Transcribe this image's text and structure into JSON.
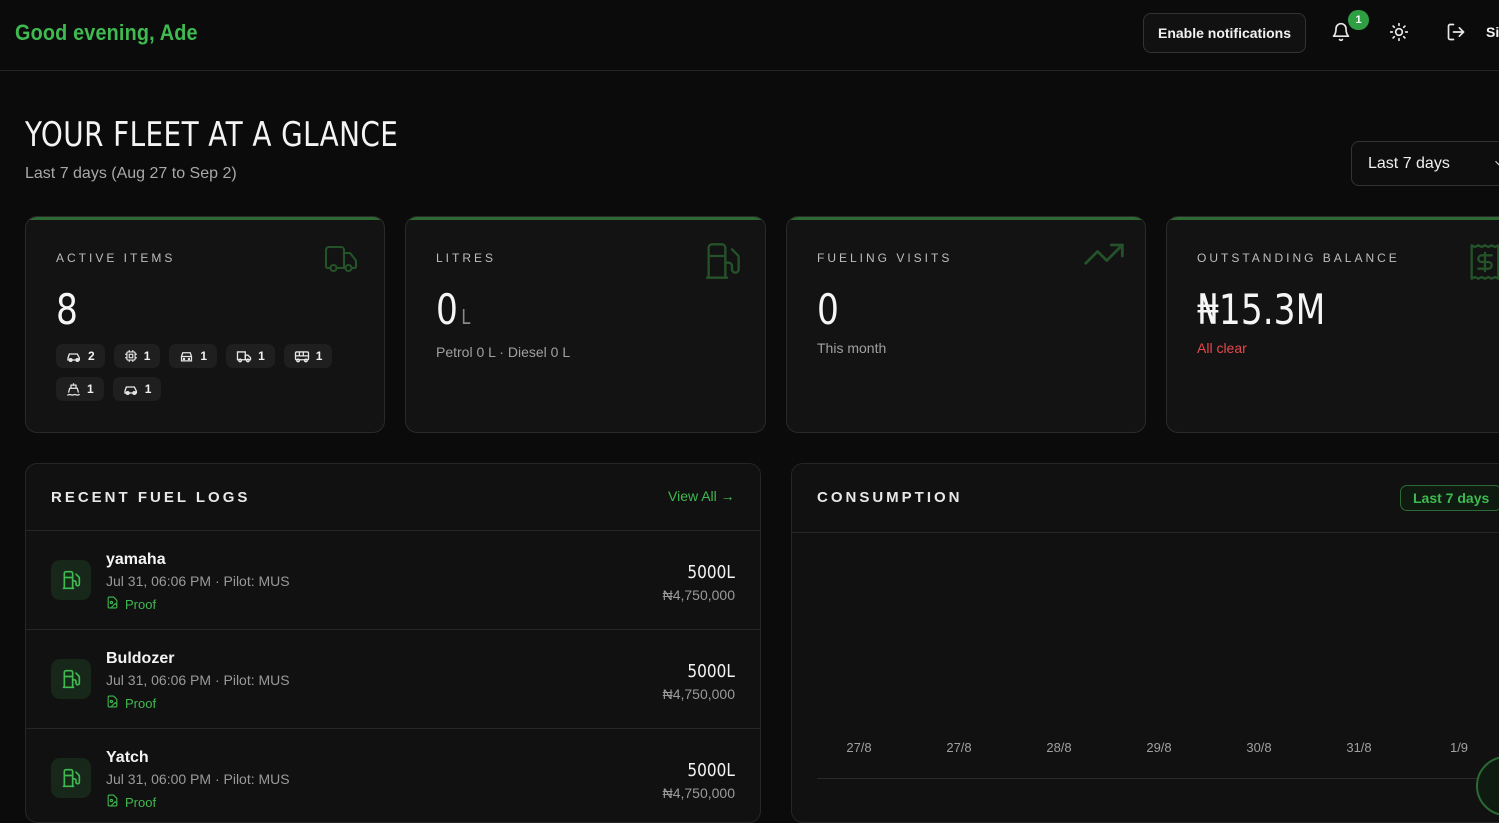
{
  "header": {
    "greeting": "Good evening, Ade",
    "enable_notifications_label": "Enable notifications",
    "notification_count": "1",
    "signout_label": "Si"
  },
  "page": {
    "title": "YOUR FLEET AT A GLANCE",
    "subtitle": "Last 7 days (Aug 27 to Sep 2)",
    "range_select": "Last 7 days"
  },
  "cards": {
    "active_items": {
      "label": "ACTIVE ITEMS",
      "value": "8",
      "chips": [
        {
          "icon": "car-icon",
          "count": "2"
        },
        {
          "icon": "generator-icon",
          "count": "1"
        },
        {
          "icon": "car-front-icon",
          "count": "1"
        },
        {
          "icon": "truck-icon",
          "count": "1"
        },
        {
          "icon": "bus-icon",
          "count": "1"
        },
        {
          "icon": "boat-icon",
          "count": "1"
        },
        {
          "icon": "car-icon",
          "count": "1"
        }
      ]
    },
    "litres": {
      "label": "LITRES",
      "value": "0",
      "unit": "L",
      "sub": "Petrol 0 L · Diesel 0 L"
    },
    "fueling_visits": {
      "label": "FUELING VISITS",
      "value": "0",
      "sub": "This month"
    },
    "outstanding_balance": {
      "label": "OUTSTANDING BALANCE",
      "value": "₦15.3M",
      "sub": "All clear"
    }
  },
  "recent_logs": {
    "title": "RECENT FUEL LOGS",
    "view_all": "View All →",
    "items": [
      {
        "name": "yamaha",
        "meta": "Jul 31, 06:06 PM · Pilot: MUS",
        "proof": "Proof",
        "litres": "5000L",
        "amount": "₦4,750,000"
      },
      {
        "name": "Buldozer",
        "meta": "Jul 31, 06:06 PM · Pilot: MUS",
        "proof": "Proof",
        "litres": "5000L",
        "amount": "₦4,750,000"
      },
      {
        "name": "Yatch",
        "meta": "Jul 31, 06:00 PM · Pilot: MUS",
        "proof": "Proof",
        "litres": "5000L",
        "amount": "₦4,750,000"
      }
    ]
  },
  "consumption": {
    "title": "CONSUMPTION",
    "range": "Last 7 days"
  },
  "chart_data": {
    "type": "bar",
    "categories": [
      "27/8",
      "27/8",
      "28/8",
      "29/8",
      "30/8",
      "31/8",
      "1/9"
    ],
    "values": [
      0,
      0,
      0,
      0,
      0,
      0,
      0
    ],
    "title": "CONSUMPTION",
    "xlabel": "",
    "ylabel": ""
  },
  "colors": {
    "accent": "#3fb950",
    "danger": "#e5484d",
    "background": "#0b0b0b",
    "card": "#131313"
  }
}
